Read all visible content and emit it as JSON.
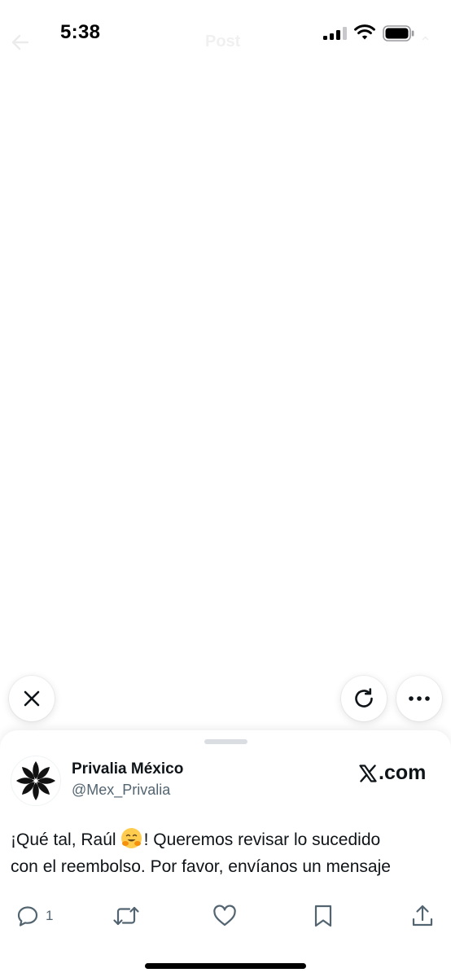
{
  "status_bar": {
    "time": "5:38"
  },
  "background_header": {
    "title": "Post"
  },
  "floating_controls": {
    "close_icon": "close-icon",
    "reload_icon": "reload-icon",
    "more_icon": "more-horizontal-icon"
  },
  "card": {
    "author": {
      "display_name": "Privalia México",
      "handle": "@Mex_Privalia",
      "avatar_icon": "flower-logo"
    },
    "source": {
      "label": ".com",
      "logo_icon": "x-logo-icon"
    },
    "post": {
      "line1_before_emoji": "¡Qué tal, Raúl",
      "emoji": "hugging-face-emoji",
      "line1_after_emoji": "! Queremos revisar lo sucedido",
      "line2": "con el reembolso. Por favor, envíanos un mensaje"
    },
    "actions": {
      "reply_count": "1"
    }
  },
  "colors": {
    "text_primary": "#0f1419",
    "text_secondary": "#536471",
    "background": "#ffffff"
  }
}
